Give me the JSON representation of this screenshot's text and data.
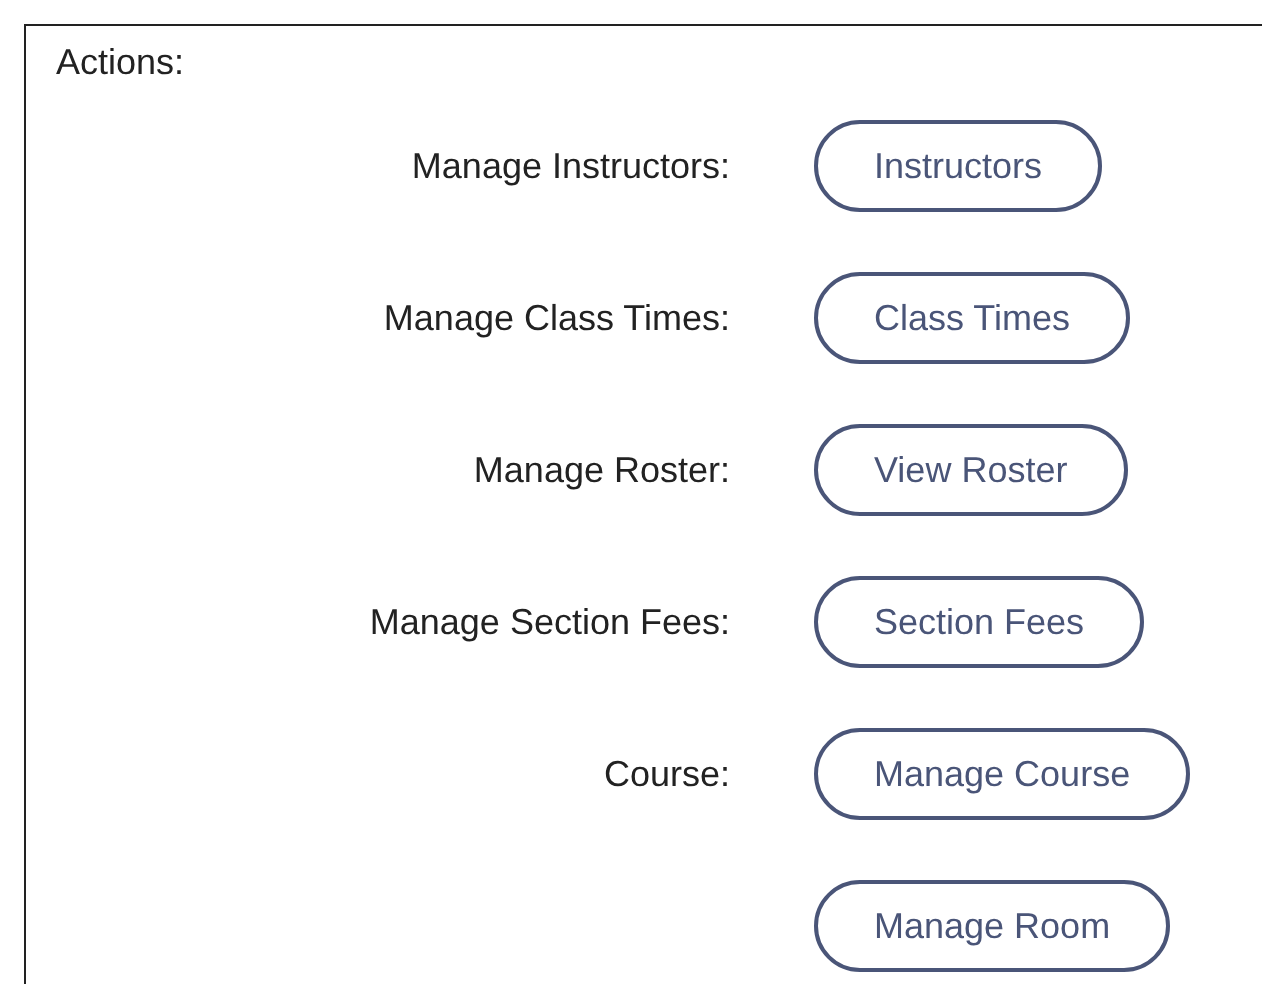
{
  "panel": {
    "title": "Actions:"
  },
  "actions": [
    {
      "label": "Manage Instructors:",
      "button": "Instructors"
    },
    {
      "label": "Manage Class Times:",
      "button": "Class Times"
    },
    {
      "label": "Manage Roster:",
      "button": "View Roster"
    },
    {
      "label": "Manage Section Fees:",
      "button": "Section Fees"
    },
    {
      "label": "Course:",
      "button": "Manage Course"
    },
    {
      "button": "Manage Room"
    }
  ]
}
